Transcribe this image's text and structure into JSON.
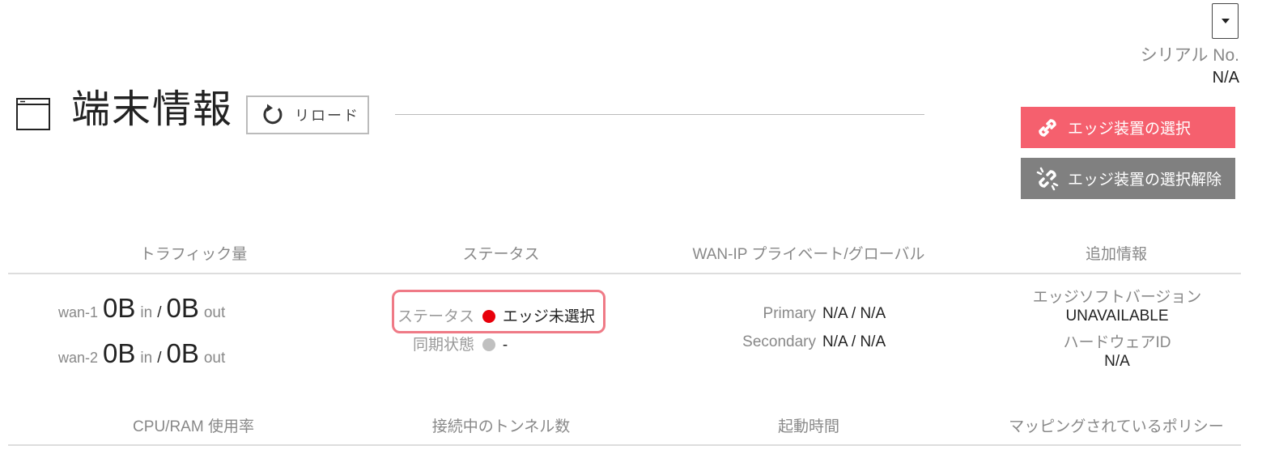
{
  "header": {
    "serial_label": "シリアル No.",
    "serial_value": "N/A",
    "title": "端末情報",
    "reload_label": "リロード"
  },
  "actions": {
    "select_edge": "エッジ装置の選択",
    "unselect_edge": "エッジ装置の選択解除"
  },
  "section1": {
    "headers": [
      "トラフィック量",
      "ステータス",
      "WAN-IP プライベート/グローバル",
      "追加情報"
    ],
    "traffic": [
      {
        "wan": "wan-1",
        "in_value": "0B",
        "in_unit": "in",
        "slash": "/",
        "out_value": "0B",
        "out_unit": "out"
      },
      {
        "wan": "wan-2",
        "in_value": "0B",
        "in_unit": "in",
        "slash": "/",
        "out_value": "0B",
        "out_unit": "out"
      }
    ],
    "status": {
      "status_label": "ステータス",
      "status_value": "エッジ未選択",
      "status_color": "#e8000b",
      "sync_label": "同期状態",
      "sync_value": "-",
      "sync_color": "#c0c0c0"
    },
    "wan_ip": {
      "primary_label": "Primary",
      "primary_value": "N/A / N/A",
      "secondary_label": "Secondary",
      "secondary_value": "N/A / N/A"
    },
    "extra": {
      "edge_soft_label": "エッジソフトバージョン",
      "edge_soft_value": "UNAVAILABLE",
      "hardware_label": "ハードウェアID",
      "hardware_value": "N/A"
    }
  },
  "section2": {
    "headers": [
      "CPU/RAM 使用率",
      "接続中のトンネル数",
      "起動時間",
      "マッピングされているポリシー"
    ]
  },
  "colors": {
    "select_button": "#f5606e",
    "unselect_button": "#808080",
    "highlight_border": "#ef7a86"
  }
}
